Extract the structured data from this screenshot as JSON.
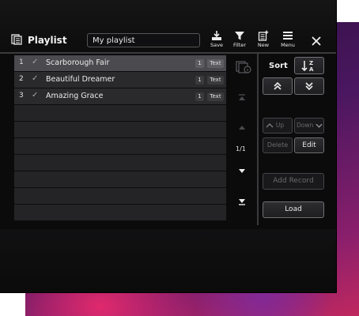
{
  "colors": {
    "screen_bg": "#0b0b0c",
    "row_bg": "#2a2a2d",
    "row_selected_bg": "#4a4a4f",
    "text": "#ececec"
  },
  "header": {
    "title": "Playlist",
    "playlist_name": "My playlist",
    "tools": [
      {
        "label": "Save",
        "icon": "save-icon"
      },
      {
        "label": "Filter",
        "icon": "filter-icon"
      },
      {
        "label": "New",
        "icon": "new-icon"
      },
      {
        "label": "Menu",
        "icon": "menu-icon"
      }
    ],
    "close_icon": "close-icon"
  },
  "list": {
    "records": [
      {
        "num": "1",
        "title": "Scarborough Fair",
        "count": "1",
        "type": "Text",
        "selected": true
      },
      {
        "num": "2",
        "title": "Beautiful Dreamer",
        "count": "1",
        "type": "Text",
        "selected": false
      },
      {
        "num": "3",
        "title": "Amazing Grace",
        "count": "1",
        "type": "Text",
        "selected": false
      }
    ]
  },
  "pager": {
    "page": "1/1"
  },
  "side": {
    "sort_label": "Sort",
    "up_label": "Up",
    "down_label": "Down",
    "delete_label": "Delete",
    "edit_label": "Edit",
    "add_record_label": "Add Record",
    "load_label": "Load"
  }
}
